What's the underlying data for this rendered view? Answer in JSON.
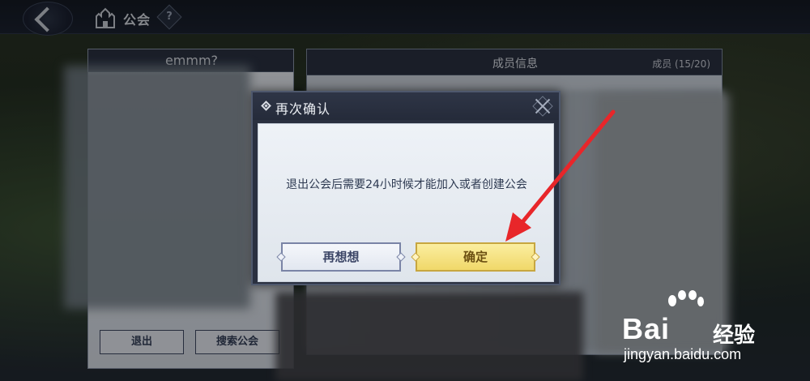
{
  "topbar": {
    "title": "公会",
    "help_label": "?"
  },
  "guild_panel": {
    "name": "emmm?",
    "quit_label": "退出",
    "search_label": "搜索公会"
  },
  "member_panel": {
    "title": "成员信息",
    "count_label": "成员 (15/20)"
  },
  "dialog": {
    "title": "再次确认",
    "message": "退出公会后需要24小时候才能加入或者创建公会",
    "cancel_label": "再想想",
    "confirm_label": "确定"
  },
  "watermark": {
    "logo": "Bai",
    "logo_cn": "经验",
    "url": "jingyan.baidu.com"
  },
  "colors": {
    "annotation_arrow": "#e8262a",
    "confirm_button": "#f0d869",
    "cancel_button_border": "#7a84a6"
  }
}
